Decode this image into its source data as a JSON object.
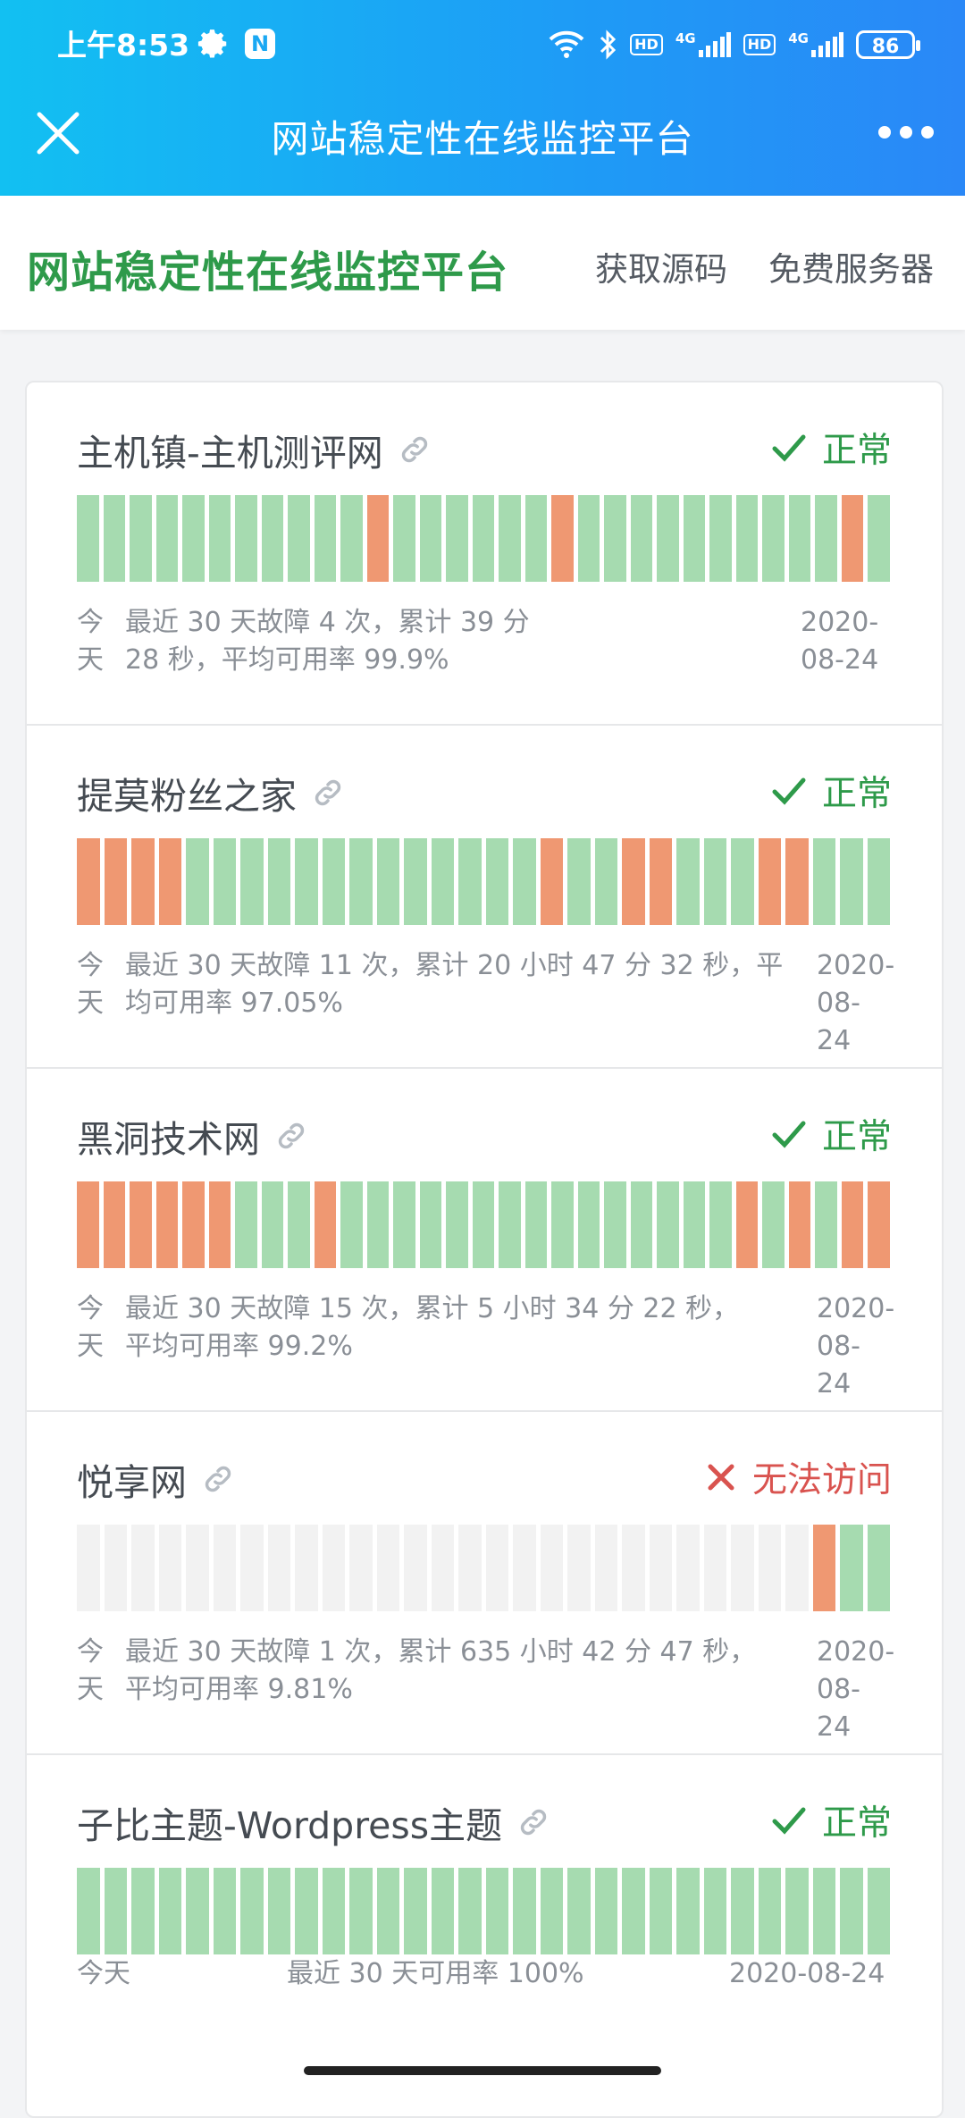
{
  "status_bar": {
    "time": "上午8:53",
    "app_badge": "N",
    "hd1": "HD",
    "net1": "4G",
    "hd2": "HD",
    "net2": "4G",
    "battery": "86"
  },
  "nav": {
    "title": "网站稳定性在线监控平台",
    "close_icon": "close-icon",
    "more_icon": "more-icon"
  },
  "header": {
    "brand": "网站稳定性在线监控平台",
    "links": [
      "获取源码",
      "免费服务器"
    ]
  },
  "colors": {
    "up": "#a6dbb0",
    "down": "#ef9872",
    "none": "#f2f2f2",
    "ok_text": "#2e9a4a",
    "fail_text": "#d9534f"
  },
  "monitors": [
    {
      "name": "主机镇-主机测评网",
      "status": "正常",
      "state": "ok",
      "bars": [
        "u",
        "u",
        "u",
        "u",
        "u",
        "u",
        "u",
        "u",
        "u",
        "u",
        "u",
        "d",
        "u",
        "u",
        "u",
        "u",
        "u",
        "u",
        "d",
        "u",
        "u",
        "u",
        "u",
        "u",
        "u",
        "u",
        "u",
        "u",
        "u",
        "d",
        "u"
      ],
      "today": "今天",
      "desc": "最近 30 天故障 4 次，累计 39 分 28 秒，平均可用率 99.9%",
      "date": "2020-08-24"
    },
    {
      "name": "提莫粉丝之家",
      "status": "正常",
      "state": "ok",
      "bars": [
        "d",
        "d",
        "d",
        "d",
        "u",
        "u",
        "u",
        "u",
        "u",
        "u",
        "u",
        "u",
        "u",
        "u",
        "u",
        "u",
        "u",
        "d",
        "u",
        "u",
        "d",
        "d",
        "u",
        "u",
        "u",
        "d",
        "d",
        "u",
        "u",
        "u"
      ],
      "today": "今天",
      "desc": "最近 30 天故障 11 次，累计 20 小时 47 分 32 秒，平均可用率 97.05%",
      "date": "2020-08-24"
    },
    {
      "name": "黑洞技术网",
      "status": "正常",
      "state": "ok",
      "bars": [
        "d",
        "d",
        "d",
        "d",
        "d",
        "d",
        "u",
        "u",
        "u",
        "d",
        "u",
        "u",
        "u",
        "u",
        "u",
        "u",
        "u",
        "u",
        "u",
        "u",
        "u",
        "u",
        "u",
        "u",
        "u",
        "d",
        "u",
        "d",
        "u",
        "d",
        "d"
      ],
      "today": "今天",
      "desc": "最近 30 天故障 15 次，累计 5 小时 34 分 22 秒，平均可用率 99.2%",
      "date": "2020-08-24"
    },
    {
      "name": "悦享网",
      "status": "无法访问",
      "state": "fail",
      "bars": [
        "n",
        "n",
        "n",
        "n",
        "n",
        "n",
        "n",
        "n",
        "n",
        "n",
        "n",
        "n",
        "n",
        "n",
        "n",
        "n",
        "n",
        "n",
        "n",
        "n",
        "n",
        "n",
        "n",
        "n",
        "n",
        "n",
        "n",
        "d",
        "u",
        "u"
      ],
      "today": "今天",
      "desc": "最近 30 天故障 1 次，累计 635 小时 42 分 47 秒，平均可用率 9.81%",
      "date": "2020-08-24"
    },
    {
      "name": "子比主题-Wordpress主题",
      "status": "正常",
      "state": "ok",
      "bars": [
        "u",
        "u",
        "u",
        "u",
        "u",
        "u",
        "u",
        "u",
        "u",
        "u",
        "u",
        "u",
        "u",
        "u",
        "u",
        "u",
        "u",
        "u",
        "u",
        "u",
        "u",
        "u",
        "u",
        "u",
        "u",
        "u",
        "u",
        "u",
        "u",
        "u"
      ],
      "today": "今天",
      "desc": "最近 30 天可用率 100%",
      "date": "2020-08-24"
    }
  ]
}
